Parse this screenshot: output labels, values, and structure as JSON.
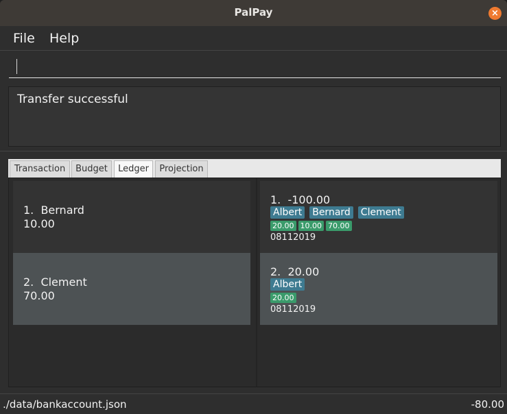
{
  "window": {
    "title": "PalPay"
  },
  "menu": {
    "file": "File",
    "help": "Help"
  },
  "command": {
    "value": "",
    "placeholder": ""
  },
  "result": {
    "message": "Transfer successful"
  },
  "tabs": [
    "Transaction",
    "Budget",
    "Ledger",
    "Projection"
  ],
  "active_tab": "Ledger",
  "ledger": [
    {
      "index": "1.",
      "name": "Bernard",
      "amount": "10.00"
    },
    {
      "index": "2.",
      "name": "Clement",
      "amount": "70.00"
    }
  ],
  "transactions": [
    {
      "index": "1.",
      "amount": "-100.00",
      "people": [
        "Albert",
        "Bernard",
        "Clement"
      ],
      "splits": [
        "20.00",
        "10.00",
        "70.00"
      ],
      "date": "08112019"
    },
    {
      "index": "2.",
      "amount": "20.00",
      "people": [
        "Albert"
      ],
      "splits": [
        "20.00"
      ],
      "date": "08112019"
    }
  ],
  "status": {
    "path": "./data/bankaccount.json",
    "balance": "-80.00"
  },
  "colors": {
    "tag": "#3e7b91",
    "amount_tag": "#3a9b6b",
    "close": "#ef7a30"
  }
}
